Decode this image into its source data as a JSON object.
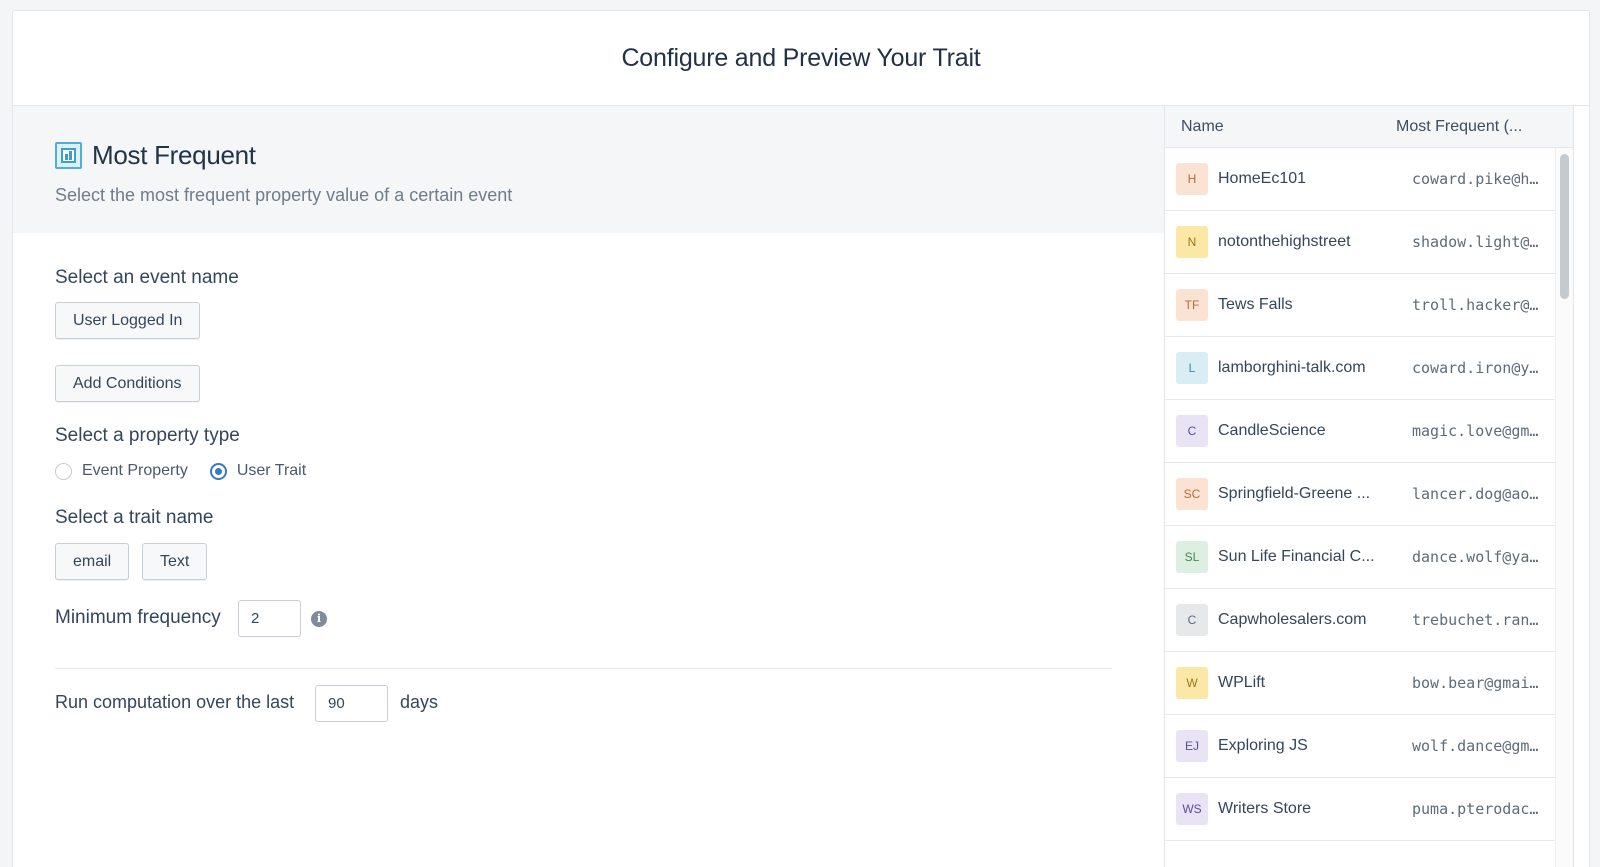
{
  "header": {
    "title": "Configure and Preview Your Trait"
  },
  "intro": {
    "icon": "most-frequent-icon",
    "title": "Most Frequent",
    "description": "Select the most frequent property value of a certain event"
  },
  "form": {
    "event_label": "Select an event name",
    "event_value": "User Logged In",
    "add_conditions": "Add Conditions",
    "property_type_label": "Select a property type",
    "property_types": [
      {
        "label": "Event Property",
        "selected": false
      },
      {
        "label": "User Trait",
        "selected": true
      }
    ],
    "trait_label": "Select a trait name",
    "trait_name": "email",
    "trait_type": "Text",
    "min_freq_label": "Minimum frequency",
    "min_freq_value": "2",
    "run_prefix": "Run computation over the last",
    "run_days": "90",
    "run_suffix": "days"
  },
  "table": {
    "columns": [
      "Name",
      "Most Frequent (..."
    ],
    "rows": [
      {
        "initials": "H",
        "name": "HomeEc101",
        "value": "coward.pike@h...",
        "bg": "#fbe3d3",
        "fg": "#b86a3a"
      },
      {
        "initials": "N",
        "name": "notonthehighstreet",
        "value": "shadow.light@...",
        "bg": "#fbe7a6",
        "fg": "#9a7a16"
      },
      {
        "initials": "TF",
        "name": "Tews Falls",
        "value": "troll.hacker@...",
        "bg": "#fbe3d3",
        "fg": "#b86a3a"
      },
      {
        "initials": "L",
        "name": "lamborghini-talk.com",
        "value": "coward.iron@y...",
        "bg": "#d8eef4",
        "fg": "#3d8ba3"
      },
      {
        "initials": "C",
        "name": "CandleScience",
        "value": "magic.love@gm...",
        "bg": "#e8e4f6",
        "fg": "#5b4c9c"
      },
      {
        "initials": "SC",
        "name": "Springfield-Greene ...",
        "value": "lancer.dog@ao...",
        "bg": "#fbe3d3",
        "fg": "#b86a3a"
      },
      {
        "initials": "SL",
        "name": "Sun Life Financial C...",
        "value": "dance.wolf@ya...",
        "bg": "#dcefe1",
        "fg": "#3d8b55"
      },
      {
        "initials": "C",
        "name": "Capwholesalers.com",
        "value": "trebuchet.ran...",
        "bg": "#e6e8ea",
        "fg": "#5e6b78"
      },
      {
        "initials": "W",
        "name": "WPLift",
        "value": "bow.bear@gmai...",
        "bg": "#fbe7a6",
        "fg": "#9a7a16"
      },
      {
        "initials": "EJ",
        "name": "Exploring JS",
        "value": "wolf.dance@gm...",
        "bg": "#e8e4f6",
        "fg": "#5b4c9c"
      },
      {
        "initials": "WS",
        "name": "Writers Store",
        "value": "puma.pterodac...",
        "bg": "#e8e4f6",
        "fg": "#5b4c9c"
      }
    ]
  }
}
